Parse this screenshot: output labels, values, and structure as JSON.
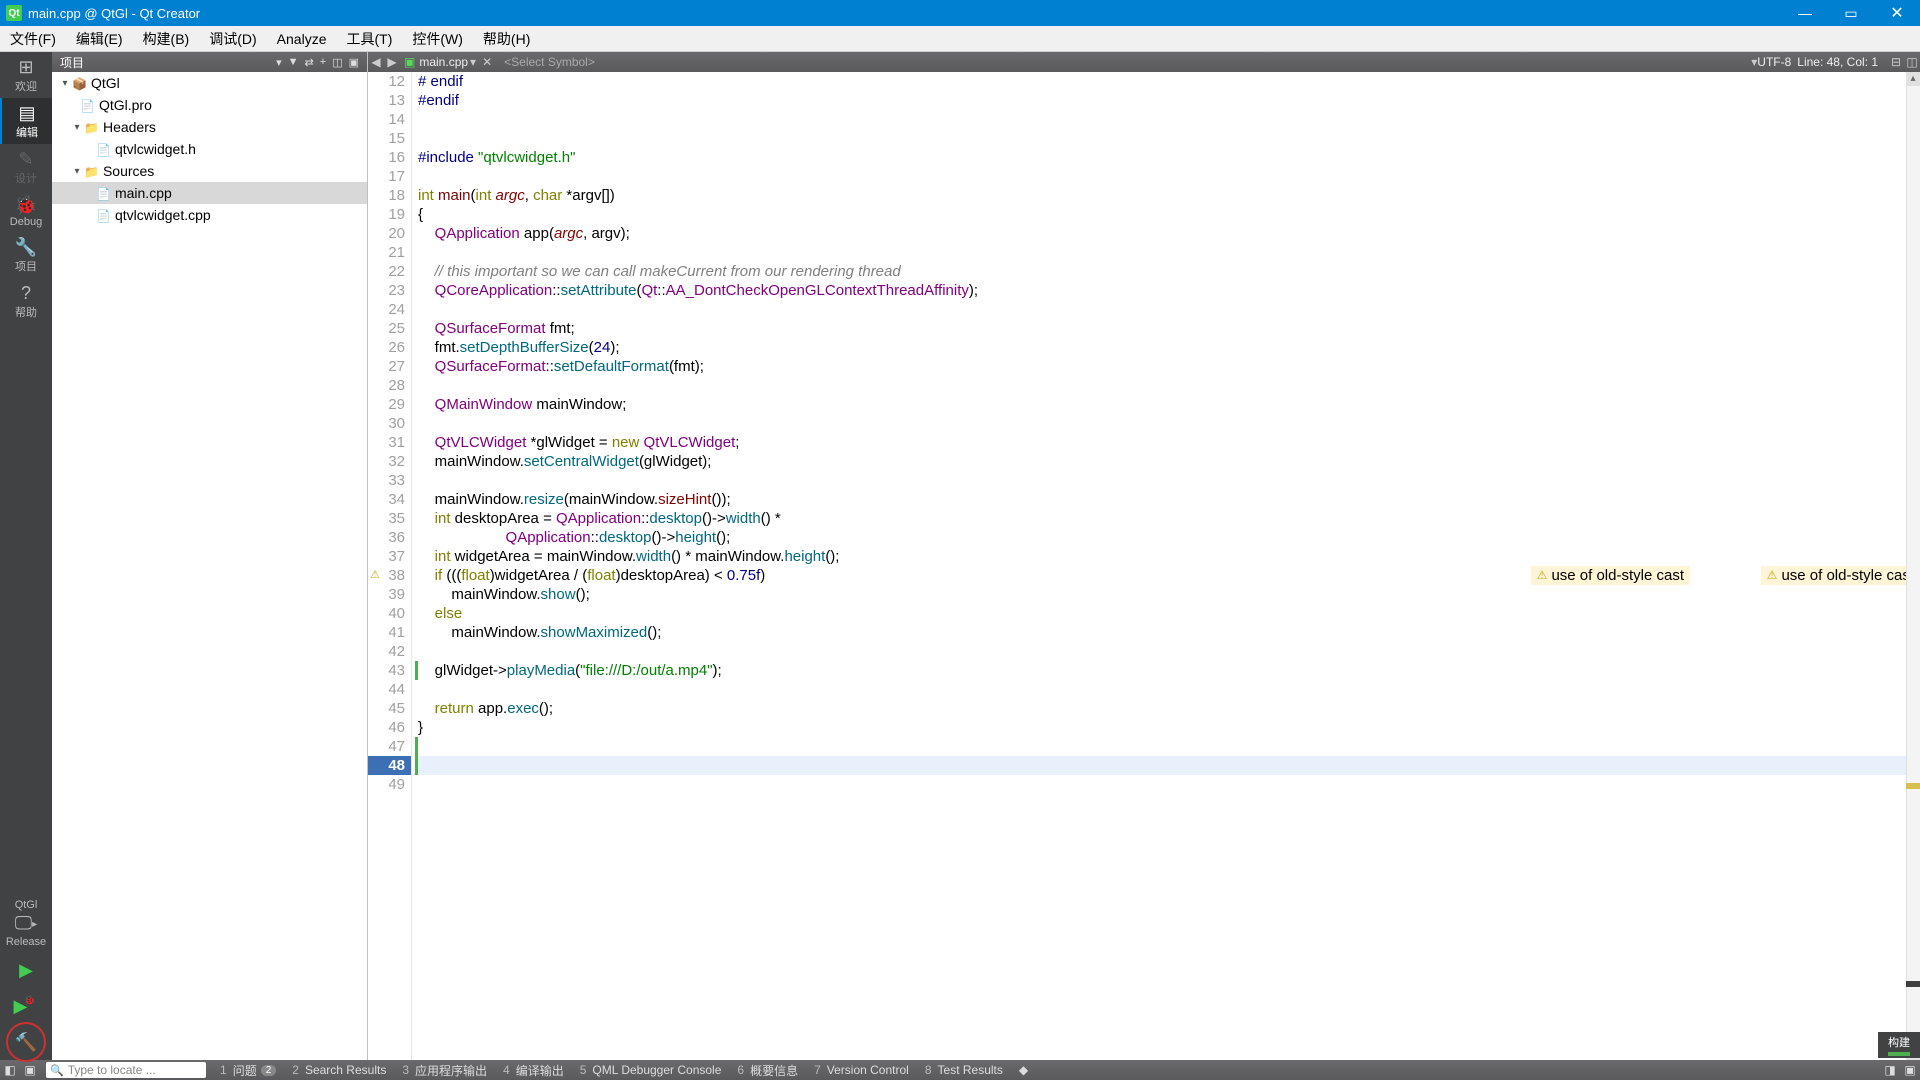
{
  "window": {
    "title": "main.cpp @ QtGl - Qt Creator",
    "appIconText": "Qt"
  },
  "menu": [
    "文件(F)",
    "编辑(E)",
    "构建(B)",
    "调试(D)",
    "Analyze",
    "工具(T)",
    "控件(W)",
    "帮助(H)"
  ],
  "modes": [
    {
      "icon": "⊞",
      "label": "欢迎",
      "active": false,
      "dim": false
    },
    {
      "icon": "▤",
      "label": "编辑",
      "active": true,
      "dim": false
    },
    {
      "icon": "✎",
      "label": "设计",
      "active": false,
      "dim": true
    },
    {
      "icon": "🐞",
      "label": "Debug",
      "active": false,
      "dim": false
    },
    {
      "icon": "🔧",
      "label": "项目",
      "active": false,
      "dim": false
    },
    {
      "icon": "?",
      "label": "帮助",
      "active": false,
      "dim": false
    }
  ],
  "kit": {
    "name": "QtGl",
    "config": "Release",
    "arrow": "▸"
  },
  "actions": {
    "run": "▶",
    "runDebug": "▶",
    "build": "🔨"
  },
  "projectHeader": {
    "title": "项目"
  },
  "projectTree": {
    "root": "QtGl",
    "proFile": "QtGl.pro",
    "headers": "Headers",
    "headerFiles": [
      "qtvlcwidget.h"
    ],
    "sources": "Sources",
    "sourceFiles": [
      "main.cpp",
      "qtvlcwidget.cpp"
    ],
    "selected": "main.cpp"
  },
  "editorToolbar": {
    "back": "◀",
    "fwd": "▶",
    "fileName": "main.cpp",
    "dropdown": "▾",
    "close": "✕",
    "symbol": "<Select Symbol>",
    "encoding": "UTF-8",
    "position": "Line: 48, Col: 1"
  },
  "buildBadge": "构建",
  "warnings": {
    "w1": "use of old-style cast",
    "w2": "use of old-style cast"
  },
  "code": {
    "startLine": 12,
    "currentLine": 48,
    "lines": [
      {
        "n": 12,
        "html": "<span class='pp'># endif</span>"
      },
      {
        "n": 13,
        "html": "<span class='pp'>#endif</span>"
      },
      {
        "n": 14,
        "html": "&nbsp;"
      },
      {
        "n": 15,
        "html": "&nbsp;"
      },
      {
        "n": 16,
        "html": "<span class='pp'>#include </span><span class='str'>\"qtvlcwidget.h\"</span>"
      },
      {
        "n": 17,
        "html": "&nbsp;"
      },
      {
        "n": 18,
        "html": "<span class='kw'>int</span> <span class='fnred'>main</span>(<span class='kw'>int</span> <span class='idit'>argc</span>, <span class='kw'>char</span> *argv[])",
        "fold": true
      },
      {
        "n": 19,
        "html": "{"
      },
      {
        "n": 20,
        "html": "    <span class='ty'>QApplication</span> <span class='id'>app</span>(<span class='idit'>argc</span>, argv);"
      },
      {
        "n": 21,
        "html": "&nbsp;"
      },
      {
        "n": 22,
        "html": "    <span class='cm'>// this important so we can call makeCurrent from our rendering thread</span>"
      },
      {
        "n": 23,
        "html": "    <span class='ty'>QCoreApplication</span>::<span class='fn'>setAttribute</span>(<span class='ty'>Qt</span>::<span class='ty'>AA_DontCheckOpenGLContextThreadAffinity</span>);"
      },
      {
        "n": 24,
        "html": "&nbsp;"
      },
      {
        "n": 25,
        "html": "    <span class='ty'>QSurfaceFormat</span> fmt;"
      },
      {
        "n": 26,
        "html": "    fmt.<span class='fn'>setDepthBufferSize</span>(<span class='num'>24</span>);"
      },
      {
        "n": 27,
        "html": "    <span class='ty'>QSurfaceFormat</span>::<span class='fn'>setDefaultFormat</span>(fmt);"
      },
      {
        "n": 28,
        "html": "&nbsp;"
      },
      {
        "n": 29,
        "html": "    <span class='ty'>QMainWindow</span> mainWindow;"
      },
      {
        "n": 30,
        "html": "&nbsp;"
      },
      {
        "n": 31,
        "html": "    <span class='ty'>QtVLCWidget</span> *glWidget = <span class='kw'>new</span> <span class='ty'>QtVLCWidget</span>;"
      },
      {
        "n": 32,
        "html": "    mainWindow.<span class='fn'>setCentralWidget</span>(glWidget);"
      },
      {
        "n": 33,
        "html": "&nbsp;"
      },
      {
        "n": 34,
        "html": "    mainWindow.<span class='fn'>resize</span>(mainWindow.<span class='fnred'>sizeHint</span>());"
      },
      {
        "n": 35,
        "html": "    <span class='kw'>int</span> desktopArea = <span class='ty'>QApplication</span>::<span class='fn'>desktop</span>()-&gt;<span class='fn'>width</span>() *"
      },
      {
        "n": 36,
        "html": "                     <span class='ty'>QApplication</span>::<span class='fn'>desktop</span>()-&gt;<span class='fn'>height</span>();"
      },
      {
        "n": 37,
        "html": "    <span class='kw'>int</span> widgetArea = mainWindow.<span class='fn'>width</span>() * mainWindow.<span class='fn'>height</span>();"
      },
      {
        "n": 38,
        "html": "    <span class='kw'>if</span> (((<span class='kw'>float</span>)widgetArea / (<span class='kw'>float</span>)desktopArea) &lt; <span class='num'>0.75f</span>)",
        "warn": true
      },
      {
        "n": 39,
        "html": "        mainWindow.<span class='fn'>show</span>();"
      },
      {
        "n": 40,
        "html": "    <span class='kw'>else</span>"
      },
      {
        "n": 41,
        "html": "        mainWindow.<span class='fn'>showMaximized</span>();"
      },
      {
        "n": 42,
        "html": "&nbsp;"
      },
      {
        "n": 43,
        "html": "    glWidget-&gt;<span class='fn'>playMedia</span>(<span class='str'>\"file:///D:/out/a.mp4\"</span>);",
        "green": true
      },
      {
        "n": 44,
        "html": "&nbsp;"
      },
      {
        "n": 45,
        "html": "    <span class='kw'>return</span> app.<span class='fn'>exec</span>();"
      },
      {
        "n": 46,
        "html": "}"
      },
      {
        "n": 47,
        "html": "&nbsp;",
        "green": true
      },
      {
        "n": 48,
        "html": "&nbsp;",
        "green": true,
        "current": true
      },
      {
        "n": 49,
        "html": "&nbsp;"
      }
    ]
  },
  "status": {
    "locatePlaceholder": "Type to locate ...",
    "panes": [
      {
        "n": "1",
        "label": "问题",
        "count": "2"
      },
      {
        "n": "2",
        "label": "Search Results"
      },
      {
        "n": "3",
        "label": "应用程序输出"
      },
      {
        "n": "4",
        "label": "编译输出"
      },
      {
        "n": "5",
        "label": "QML Debugger Console"
      },
      {
        "n": "6",
        "label": "概要信息"
      },
      {
        "n": "7",
        "label": "Version Control"
      },
      {
        "n": "8",
        "label": "Test Results"
      }
    ]
  }
}
